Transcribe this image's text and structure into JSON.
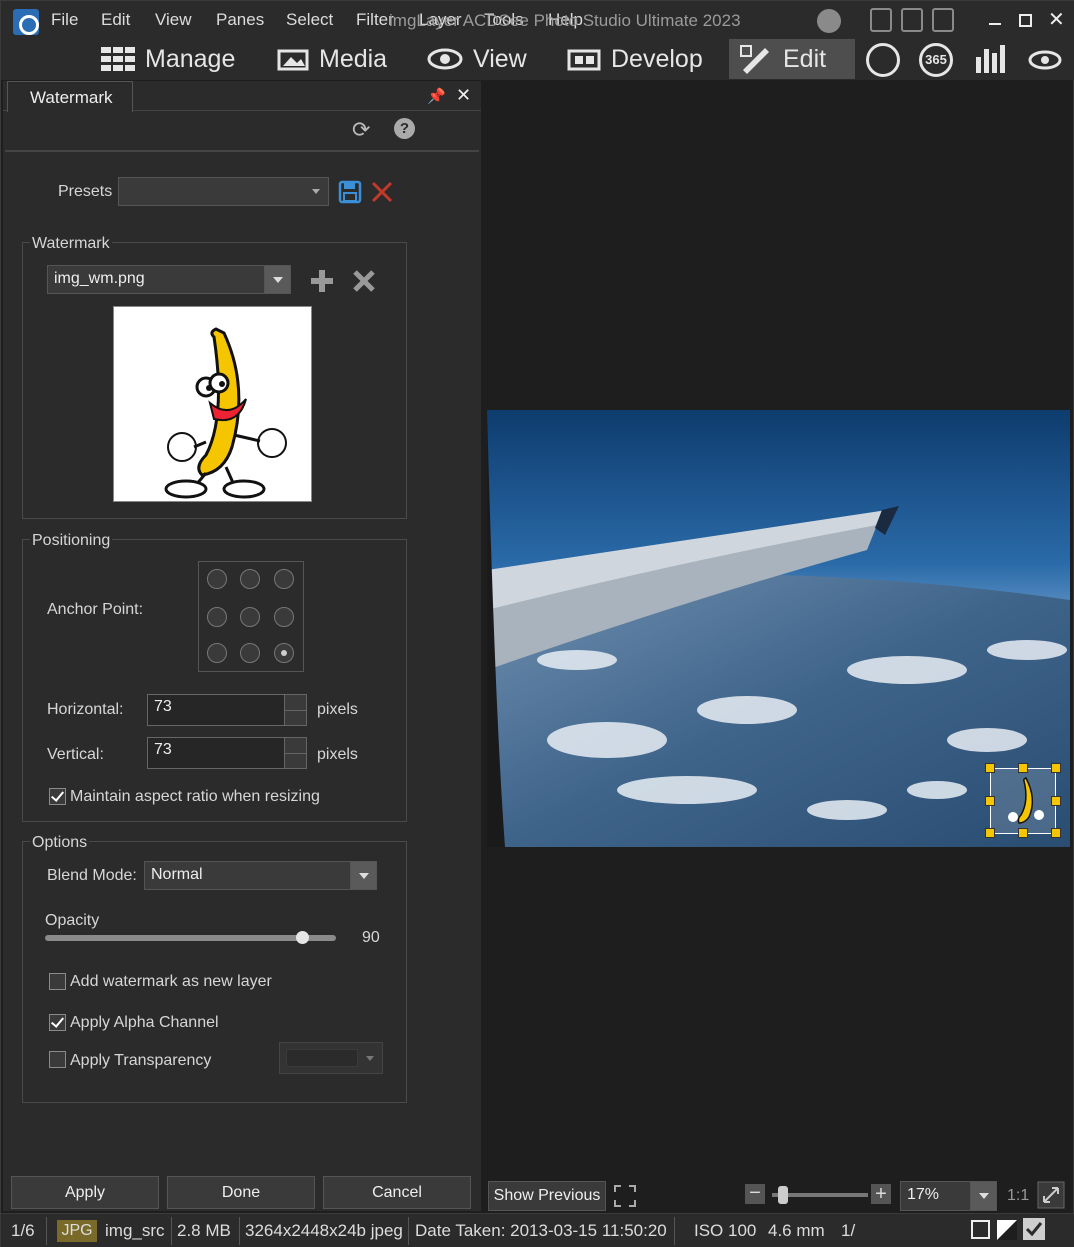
{
  "window": {
    "title": "imgLayer ACDSee Photo Studio Ultimate 2023",
    "menu": [
      "File",
      "Edit",
      "View",
      "Panes",
      "Select",
      "Filter",
      "Layer",
      "Tools",
      "Help"
    ]
  },
  "modes": [
    {
      "label": "Manage",
      "icon": "grid-icon"
    },
    {
      "label": "Media",
      "icon": "media-icon"
    },
    {
      "label": "View",
      "icon": "eye-icon"
    },
    {
      "label": "Develop",
      "icon": "develop-icon"
    },
    {
      "label": "Edit",
      "icon": "edit-icon",
      "active": true
    }
  ],
  "mode_extra_icons": [
    "people-icon",
    "365-icon",
    "dashboard-icon",
    "eye-refresh-icon"
  ],
  "mode_365": "365",
  "panel": {
    "tab": "Watermark",
    "presets_label": "Presets",
    "presets_value": "",
    "watermark_group": "Watermark",
    "watermark_file": "img_wm.png",
    "positioning_group": "Positioning",
    "anchor_label": "Anchor Point:",
    "anchor_selected": "bottom-right",
    "horizontal_label": "Horizontal:",
    "horizontal_value": "73",
    "vertical_label": "Vertical:",
    "vertical_value": "73",
    "pixels_label": "pixels",
    "aspect_label": "Maintain aspect ratio when resizing",
    "aspect_checked": true,
    "options_group": "Options",
    "blend_label": "Blend Mode:",
    "blend_value": "Normal",
    "opacity_label": "Opacity",
    "opacity_value": "90",
    "new_layer_label": "Add watermark as new layer",
    "new_layer_checked": false,
    "alpha_label": "Apply Alpha Channel",
    "alpha_checked": true,
    "transparency_label": "Apply Transparency",
    "transparency_checked": false,
    "apply_label": "Apply",
    "done_label": "Done",
    "cancel_label": "Cancel"
  },
  "viewer": {
    "show_previous": "Show Previous",
    "zoom_value": "17%",
    "one_to_one": "1:1"
  },
  "status": {
    "index": "1/6",
    "type": "JPG",
    "filename": "img_src",
    "filesize": "2.8 MB",
    "dimensions": "3264x2448x24b jpeg",
    "date_taken": "Date Taken: 2013-03-15 11:50:20",
    "iso": "ISO 100",
    "focal": "4.6 mm",
    "exposure": "1/"
  },
  "colors": {
    "accent_yellow": "#f5c500",
    "save_blue": "#3a8fd6",
    "delete_red": "#c0392b",
    "sky": "#1f5a96"
  }
}
